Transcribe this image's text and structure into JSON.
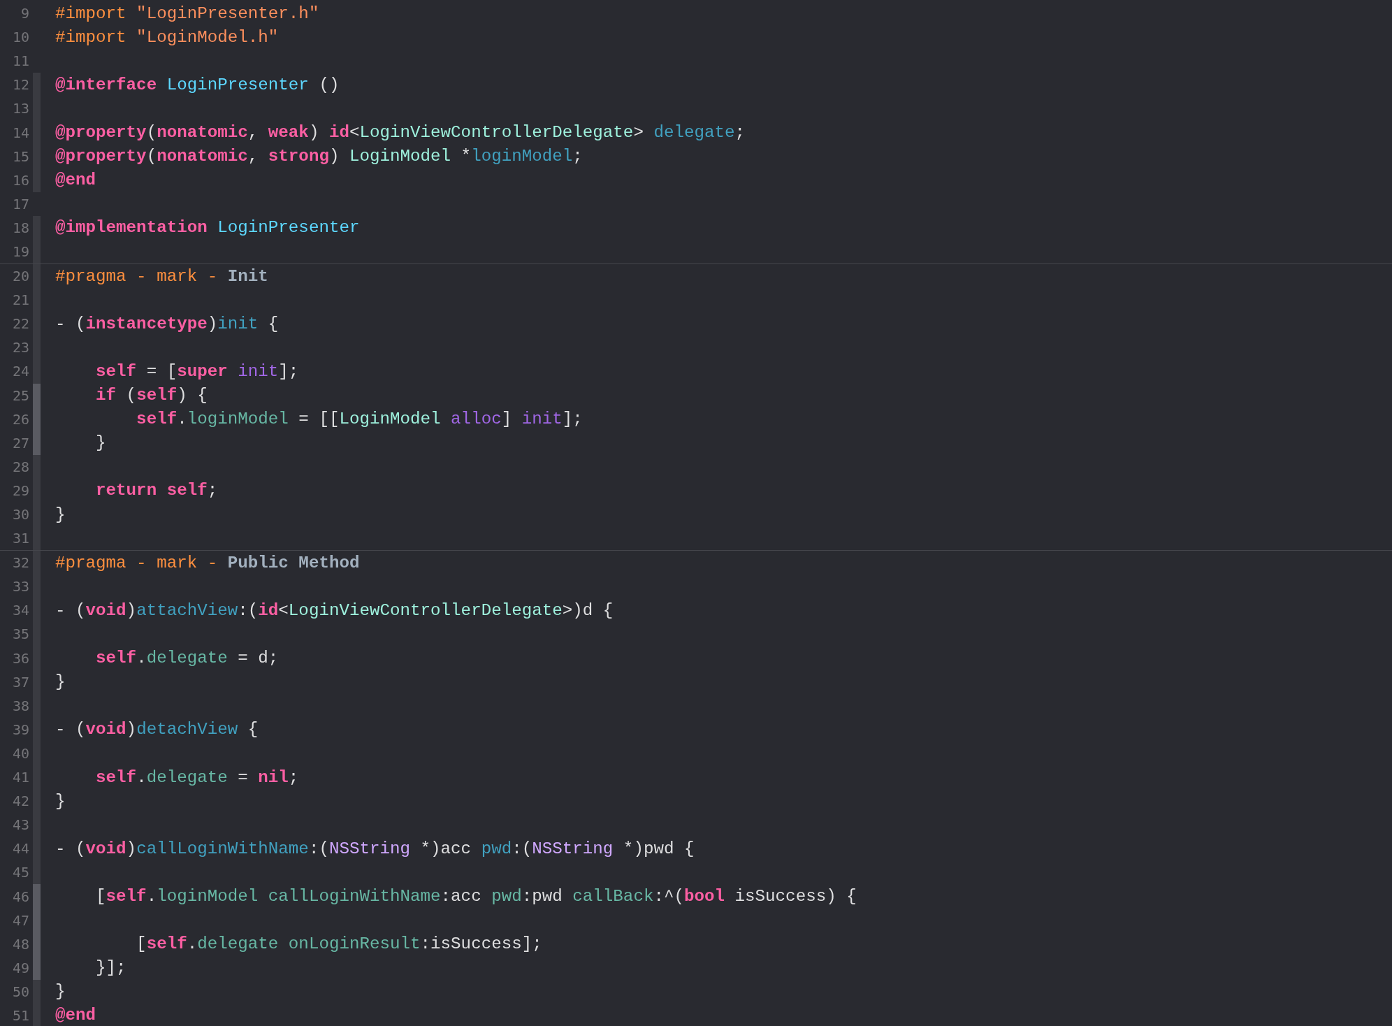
{
  "editor": {
    "lines": [
      {
        "number": "9",
        "in_scope": false,
        "separator": false,
        "tokens": [
          {
            "text": "#import",
            "kind": "preproc"
          },
          {
            "text": " \"LoginPresenter.h\"",
            "kind": "string"
          }
        ]
      },
      {
        "number": "10",
        "in_scope": false,
        "separator": false,
        "tokens": [
          {
            "text": "#import",
            "kind": "preproc"
          },
          {
            "text": " \"LoginModel.h\"",
            "kind": "string"
          }
        ]
      },
      {
        "number": "11",
        "in_scope": false,
        "separator": false
      },
      {
        "number": "12",
        "in_scope": true,
        "nested": false,
        "separator": false,
        "tokens": [
          {
            "text": "@interface",
            "kind": "keyword"
          },
          {
            "text": " LoginPresenter",
            "kind": "classdecl"
          },
          {
            "text": " ()",
            "kind": "plain"
          }
        ]
      },
      {
        "number": "13",
        "in_scope": true,
        "nested": false,
        "separator": false
      },
      {
        "number": "14",
        "in_scope": true,
        "nested": false,
        "separator": false,
        "tokens": [
          {
            "text": "@property",
            "kind": "keyword"
          },
          {
            "text": "(",
            "kind": "plain"
          },
          {
            "text": "nonatomic",
            "kind": "keyword"
          },
          {
            "text": ", ",
            "kind": "plain"
          },
          {
            "text": "weak",
            "kind": "keyword"
          },
          {
            "text": ") ",
            "kind": "plain"
          },
          {
            "text": "id",
            "kind": "keyword"
          },
          {
            "text": "<",
            "kind": "plain"
          },
          {
            "text": "LoginViewControllerDelegate",
            "kind": "type"
          },
          {
            "text": "> ",
            "kind": "plain"
          },
          {
            "text": "delegate",
            "kind": "property"
          },
          {
            "text": ";",
            "kind": "plain"
          }
        ]
      },
      {
        "number": "15",
        "in_scope": true,
        "nested": false,
        "separator": false,
        "tokens": [
          {
            "text": "@property",
            "kind": "keyword"
          },
          {
            "text": "(",
            "kind": "plain"
          },
          {
            "text": "nonatomic",
            "kind": "keyword"
          },
          {
            "text": ", ",
            "kind": "plain"
          },
          {
            "text": "strong",
            "kind": "keyword"
          },
          {
            "text": ") ",
            "kind": "plain"
          },
          {
            "text": "LoginModel",
            "kind": "type"
          },
          {
            "text": " *",
            "kind": "plain"
          },
          {
            "text": "loginModel",
            "kind": "property"
          },
          {
            "text": ";",
            "kind": "plain"
          }
        ]
      },
      {
        "number": "16",
        "in_scope": true,
        "nested": false,
        "separator": false,
        "tokens": [
          {
            "text": "@end",
            "kind": "keyword"
          }
        ]
      },
      {
        "number": "17",
        "in_scope": false,
        "separator": false
      },
      {
        "number": "18",
        "in_scope": true,
        "nested": false,
        "separator": false,
        "tokens": [
          {
            "text": "@implementation",
            "kind": "keyword"
          },
          {
            "text": " LoginPresenter",
            "kind": "classdecl"
          }
        ]
      },
      {
        "number": "19",
        "in_scope": true,
        "nested": false,
        "separator": false
      },
      {
        "number": "20",
        "in_scope": true,
        "nested": false,
        "separator": true,
        "tokens": [
          {
            "text": "#pragma - mark -",
            "kind": "preproc"
          },
          {
            "text": " Init",
            "kind": "mark"
          }
        ]
      },
      {
        "number": "21",
        "in_scope": true,
        "nested": false,
        "separator": false
      },
      {
        "number": "22",
        "in_scope": true,
        "nested": false,
        "separator": false,
        "tokens": [
          {
            "text": "- (",
            "kind": "plain"
          },
          {
            "text": "instancetype",
            "kind": "keyword"
          },
          {
            "text": ")",
            "kind": "plain"
          },
          {
            "text": "init",
            "kind": "property"
          },
          {
            "text": " {",
            "kind": "plain"
          }
        ]
      },
      {
        "number": "23",
        "in_scope": true,
        "nested": false,
        "separator": false
      },
      {
        "number": "24",
        "in_scope": true,
        "nested": false,
        "separator": false,
        "tokens": [
          {
            "text": "    self",
            "kind": "keyword"
          },
          {
            "text": " = [",
            "kind": "plain"
          },
          {
            "text": "super",
            "kind": "keyword"
          },
          {
            "text": " init",
            "kind": "method"
          },
          {
            "text": "];",
            "kind": "plain"
          }
        ]
      },
      {
        "number": "25",
        "in_scope": true,
        "nested": true,
        "separator": false,
        "tokens": [
          {
            "text": "    if",
            "kind": "keyword"
          },
          {
            "text": " (",
            "kind": "plain"
          },
          {
            "text": "self",
            "kind": "keyword"
          },
          {
            "text": ") {",
            "kind": "plain"
          }
        ]
      },
      {
        "number": "26",
        "in_scope": true,
        "nested": true,
        "separator": false,
        "tokens": [
          {
            "text": "        self",
            "kind": "keyword"
          },
          {
            "text": ".",
            "kind": "plain"
          },
          {
            "text": "loginModel",
            "kind": "member"
          },
          {
            "text": " = [[",
            "kind": "plain"
          },
          {
            "text": "LoginModel",
            "kind": "type"
          },
          {
            "text": " alloc",
            "kind": "method"
          },
          {
            "text": "] ",
            "kind": "plain"
          },
          {
            "text": "init",
            "kind": "method"
          },
          {
            "text": "];",
            "kind": "plain"
          }
        ]
      },
      {
        "number": "27",
        "in_scope": true,
        "nested": true,
        "separator": false,
        "tokens": [
          {
            "text": "    }",
            "kind": "plain"
          }
        ]
      },
      {
        "number": "28",
        "in_scope": true,
        "nested": false,
        "separator": false
      },
      {
        "number": "29",
        "in_scope": true,
        "nested": false,
        "separator": false,
        "tokens": [
          {
            "text": "    return",
            "kind": "keyword"
          },
          {
            "text": " self",
            "kind": "keyword"
          },
          {
            "text": ";",
            "kind": "plain"
          }
        ]
      },
      {
        "number": "30",
        "in_scope": true,
        "nested": false,
        "separator": false,
        "tokens": [
          {
            "text": "}",
            "kind": "plain"
          }
        ]
      },
      {
        "number": "31",
        "in_scope": true,
        "nested": false,
        "separator": false
      },
      {
        "number": "32",
        "in_scope": true,
        "nested": false,
        "separator": true,
        "tokens": [
          {
            "text": "#pragma - mark -",
            "kind": "preproc"
          },
          {
            "text": " Public Method",
            "kind": "mark"
          }
        ]
      },
      {
        "number": "33",
        "in_scope": true,
        "nested": false,
        "separator": false
      },
      {
        "number": "34",
        "in_scope": true,
        "nested": false,
        "separator": false,
        "tokens": [
          {
            "text": "- (",
            "kind": "plain"
          },
          {
            "text": "void",
            "kind": "keyword"
          },
          {
            "text": ")",
            "kind": "plain"
          },
          {
            "text": "attachView",
            "kind": "property"
          },
          {
            "text": ":(",
            "kind": "plain"
          },
          {
            "text": "id",
            "kind": "keyword"
          },
          {
            "text": "<",
            "kind": "plain"
          },
          {
            "text": "LoginViewControllerDelegate",
            "kind": "type"
          },
          {
            "text": ">)d {",
            "kind": "plain"
          }
        ]
      },
      {
        "number": "35",
        "in_scope": true,
        "nested": false,
        "separator": false
      },
      {
        "number": "36",
        "in_scope": true,
        "nested": false,
        "separator": false,
        "tokens": [
          {
            "text": "    self",
            "kind": "keyword"
          },
          {
            "text": ".",
            "kind": "plain"
          },
          {
            "text": "delegate",
            "kind": "member"
          },
          {
            "text": " = d;",
            "kind": "plain"
          }
        ]
      },
      {
        "number": "37",
        "in_scope": true,
        "nested": false,
        "separator": false,
        "tokens": [
          {
            "text": "}",
            "kind": "plain"
          }
        ]
      },
      {
        "number": "38",
        "in_scope": true,
        "nested": false,
        "separator": false
      },
      {
        "number": "39",
        "in_scope": true,
        "nested": false,
        "separator": false,
        "tokens": [
          {
            "text": "- (",
            "kind": "plain"
          },
          {
            "text": "void",
            "kind": "keyword"
          },
          {
            "text": ")",
            "kind": "plain"
          },
          {
            "text": "detachView",
            "kind": "property"
          },
          {
            "text": " {",
            "kind": "plain"
          }
        ]
      },
      {
        "number": "40",
        "in_scope": true,
        "nested": false,
        "separator": false
      },
      {
        "number": "41",
        "in_scope": true,
        "nested": false,
        "separator": false,
        "tokens": [
          {
            "text": "    self",
            "kind": "keyword"
          },
          {
            "text": ".",
            "kind": "plain"
          },
          {
            "text": "delegate",
            "kind": "member"
          },
          {
            "text": " = ",
            "kind": "plain"
          },
          {
            "text": "nil",
            "kind": "keyword"
          },
          {
            "text": ";",
            "kind": "plain"
          }
        ]
      },
      {
        "number": "42",
        "in_scope": true,
        "nested": false,
        "separator": false,
        "tokens": [
          {
            "text": "}",
            "kind": "plain"
          }
        ]
      },
      {
        "number": "43",
        "in_scope": true,
        "nested": false,
        "separator": false
      },
      {
        "number": "44",
        "in_scope": true,
        "nested": false,
        "separator": false,
        "tokens": [
          {
            "text": "- (",
            "kind": "plain"
          },
          {
            "text": "void",
            "kind": "keyword"
          },
          {
            "text": ")",
            "kind": "plain"
          },
          {
            "text": "callLoginWithName",
            "kind": "property"
          },
          {
            "text": ":(",
            "kind": "plain"
          },
          {
            "text": "NSString",
            "kind": "systype"
          },
          {
            "text": " *)acc ",
            "kind": "plain"
          },
          {
            "text": "pwd",
            "kind": "property"
          },
          {
            "text": ":(",
            "kind": "plain"
          },
          {
            "text": "NSString",
            "kind": "systype"
          },
          {
            "text": " *)pwd {",
            "kind": "plain"
          }
        ]
      },
      {
        "number": "45",
        "in_scope": true,
        "nested": false,
        "separator": false
      },
      {
        "number": "46",
        "in_scope": true,
        "nested": true,
        "separator": false,
        "tokens": [
          {
            "text": "    [",
            "kind": "plain"
          },
          {
            "text": "self",
            "kind": "keyword"
          },
          {
            "text": ".",
            "kind": "plain"
          },
          {
            "text": "loginModel",
            "kind": "member"
          },
          {
            "text": " callLoginWithName",
            "kind": "member"
          },
          {
            "text": ":acc ",
            "kind": "plain"
          },
          {
            "text": "pwd",
            "kind": "member"
          },
          {
            "text": ":pwd ",
            "kind": "plain"
          },
          {
            "text": "callBack",
            "kind": "member"
          },
          {
            "text": ":^(",
            "kind": "plain"
          },
          {
            "text": "bool",
            "kind": "keyword"
          },
          {
            "text": " isSuccess) {",
            "kind": "plain"
          }
        ]
      },
      {
        "number": "47",
        "in_scope": true,
        "nested": true,
        "separator": false
      },
      {
        "number": "48",
        "in_scope": true,
        "nested": true,
        "separator": false,
        "tokens": [
          {
            "text": "        [",
            "kind": "plain"
          },
          {
            "text": "self",
            "kind": "keyword"
          },
          {
            "text": ".",
            "kind": "plain"
          },
          {
            "text": "delegate",
            "kind": "member"
          },
          {
            "text": " onLoginResult",
            "kind": "member"
          },
          {
            "text": ":isSuccess];",
            "kind": "plain"
          }
        ]
      },
      {
        "number": "49",
        "in_scope": true,
        "nested": true,
        "separator": false,
        "tokens": [
          {
            "text": "    }];",
            "kind": "plain"
          }
        ]
      },
      {
        "number": "50",
        "in_scope": true,
        "nested": false,
        "separator": false,
        "tokens": [
          {
            "text": "}",
            "kind": "plain"
          }
        ]
      },
      {
        "number": "51",
        "in_scope": true,
        "nested": false,
        "separator": false,
        "tokens": [
          {
            "text": "@end",
            "kind": "keyword"
          }
        ]
      }
    ]
  }
}
